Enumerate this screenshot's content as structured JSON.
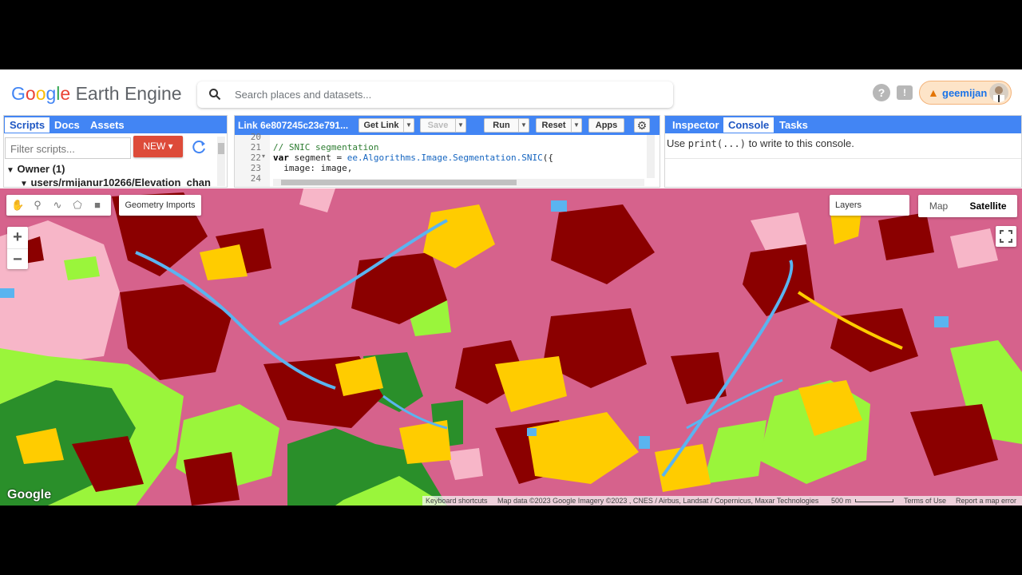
{
  "header": {
    "logo_google": [
      "G",
      "o",
      "o",
      "g",
      "l",
      "e"
    ],
    "logo_rest": "Earth Engine",
    "search_placeholder": "Search places and datasets...",
    "help_glyph": "?",
    "feedback_glyph": "!",
    "username": "geemijan"
  },
  "left_panel": {
    "tabs": [
      "Scripts",
      "Docs",
      "Assets"
    ],
    "active_tab": "Scripts",
    "filter_placeholder": "Filter scripts...",
    "new_button": "NEW",
    "owner_label": "Owner (1)",
    "script_path": "users/rmijanur10266/Elevation_chan"
  },
  "editor": {
    "link_name": "Link 6e807245c23e791...",
    "buttons": {
      "get_link": "Get Link",
      "save": "Save",
      "run": "Run",
      "reset": "Reset",
      "apps": "Apps"
    },
    "lines": [
      {
        "num": "20",
        "text": ""
      },
      {
        "num": "21",
        "text": "// SNIC segmentation"
      },
      {
        "num": "22",
        "text": "var segment = ee.Algorithms.Image.Segmentation.SNIC({"
      },
      {
        "num": "23",
        "text": "  image: image,"
      },
      {
        "num": "24",
        "text": ""
      }
    ]
  },
  "right_panel": {
    "tabs": [
      "Inspector",
      "Console",
      "Tasks"
    ],
    "active_tab": "Console",
    "console_prefix": "Use ",
    "console_code": "print(...)",
    "console_suffix": " to write to this console."
  },
  "map": {
    "geometry_imports": "Geometry Imports",
    "zoom_in": "+",
    "zoom_out": "−",
    "layers": "Layers",
    "map_type": "Map",
    "satellite_type": "Satellite",
    "active_type": "Satellite",
    "google_logo": "Google",
    "attribution": {
      "shortcuts": "Keyboard shortcuts",
      "data": "Map data ©2023 Google Imagery ©2023 , CNES / Airbus, Landsat / Copernicus, Maxar Technologies",
      "scale": "500 m",
      "terms": "Terms of Use",
      "report": "Report a map error"
    },
    "class_colors": {
      "base": "#d6628c",
      "dark_red": "#8b0000",
      "yellow": "#ffcc00",
      "light_green": "#9af53b",
      "dark_green": "#2a8f2a",
      "light_blue": "#5ab4f0",
      "pink": "#f7b6c8"
    }
  }
}
